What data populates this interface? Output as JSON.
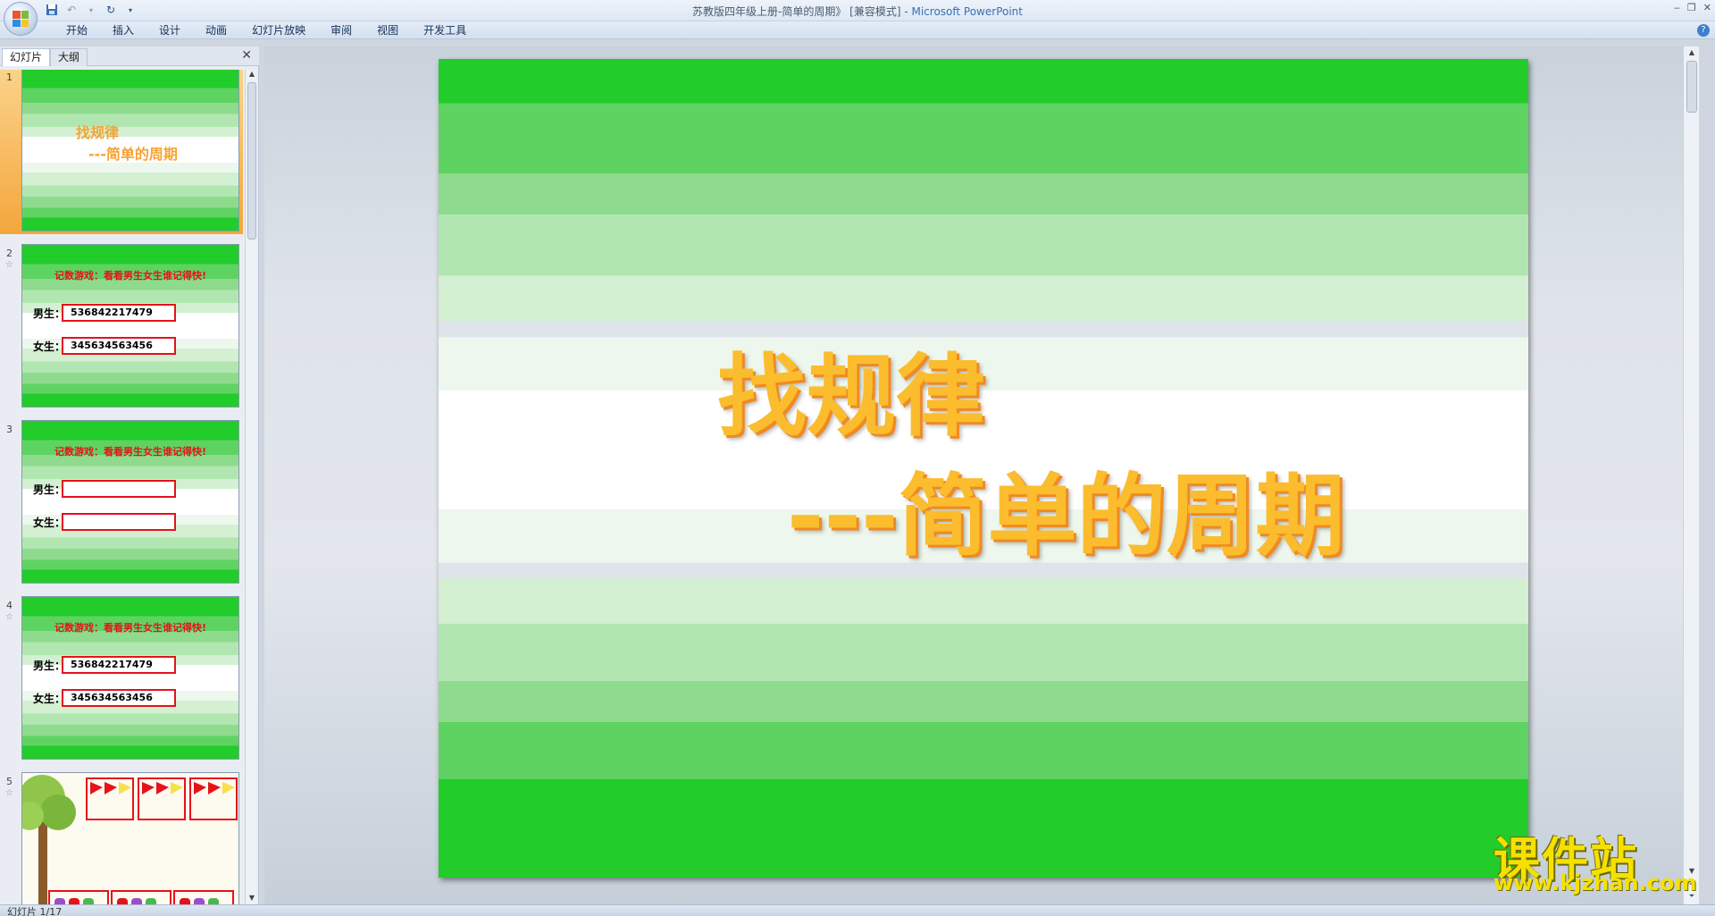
{
  "window": {
    "doc_title": "苏教版四年级上册-简单的周期》 [兼容模式] - ",
    "app_name": "Microsoft PowerPoint"
  },
  "ribbon": {
    "tabs": [
      "开始",
      "插入",
      "设计",
      "动画",
      "幻灯片放映",
      "审阅",
      "视图",
      "开发工具"
    ]
  },
  "pane": {
    "tab_slides": "幻灯片",
    "tab_outline": "大纲"
  },
  "thumbnails": [
    {
      "num": "1",
      "title1": "找规律",
      "title2": "---简单的周期"
    },
    {
      "num": "2",
      "heading": "记数游戏：看看男生女生谁记得快!",
      "boy_label": "男生：",
      "boy_value": "536842217479",
      "girl_label": "女生：",
      "girl_value": "345634563456"
    },
    {
      "num": "3",
      "heading": "记数游戏：看看男生女生谁记得快!",
      "boy_label": "男生：",
      "boy_value": "",
      "girl_label": "女生：",
      "girl_value": ""
    },
    {
      "num": "4",
      "heading": "记数游戏：看看男生女生谁记得快!",
      "boy_label": "男生：",
      "boy_value": "536842217479",
      "girl_label": "女生：",
      "girl_value": "345634563456"
    },
    {
      "num": "5"
    }
  ],
  "slide": {
    "title": "找规律",
    "subtitle": "---简单的周期"
  },
  "watermark": {
    "brand": "课件站",
    "url": "www.kjzhan.com"
  },
  "status": {
    "slide_counter": "幻灯片 1/17"
  },
  "colors": {
    "stripe_dark": "#22cc2b",
    "title_orange": "#f7a233",
    "box_red": "#e5121a"
  }
}
